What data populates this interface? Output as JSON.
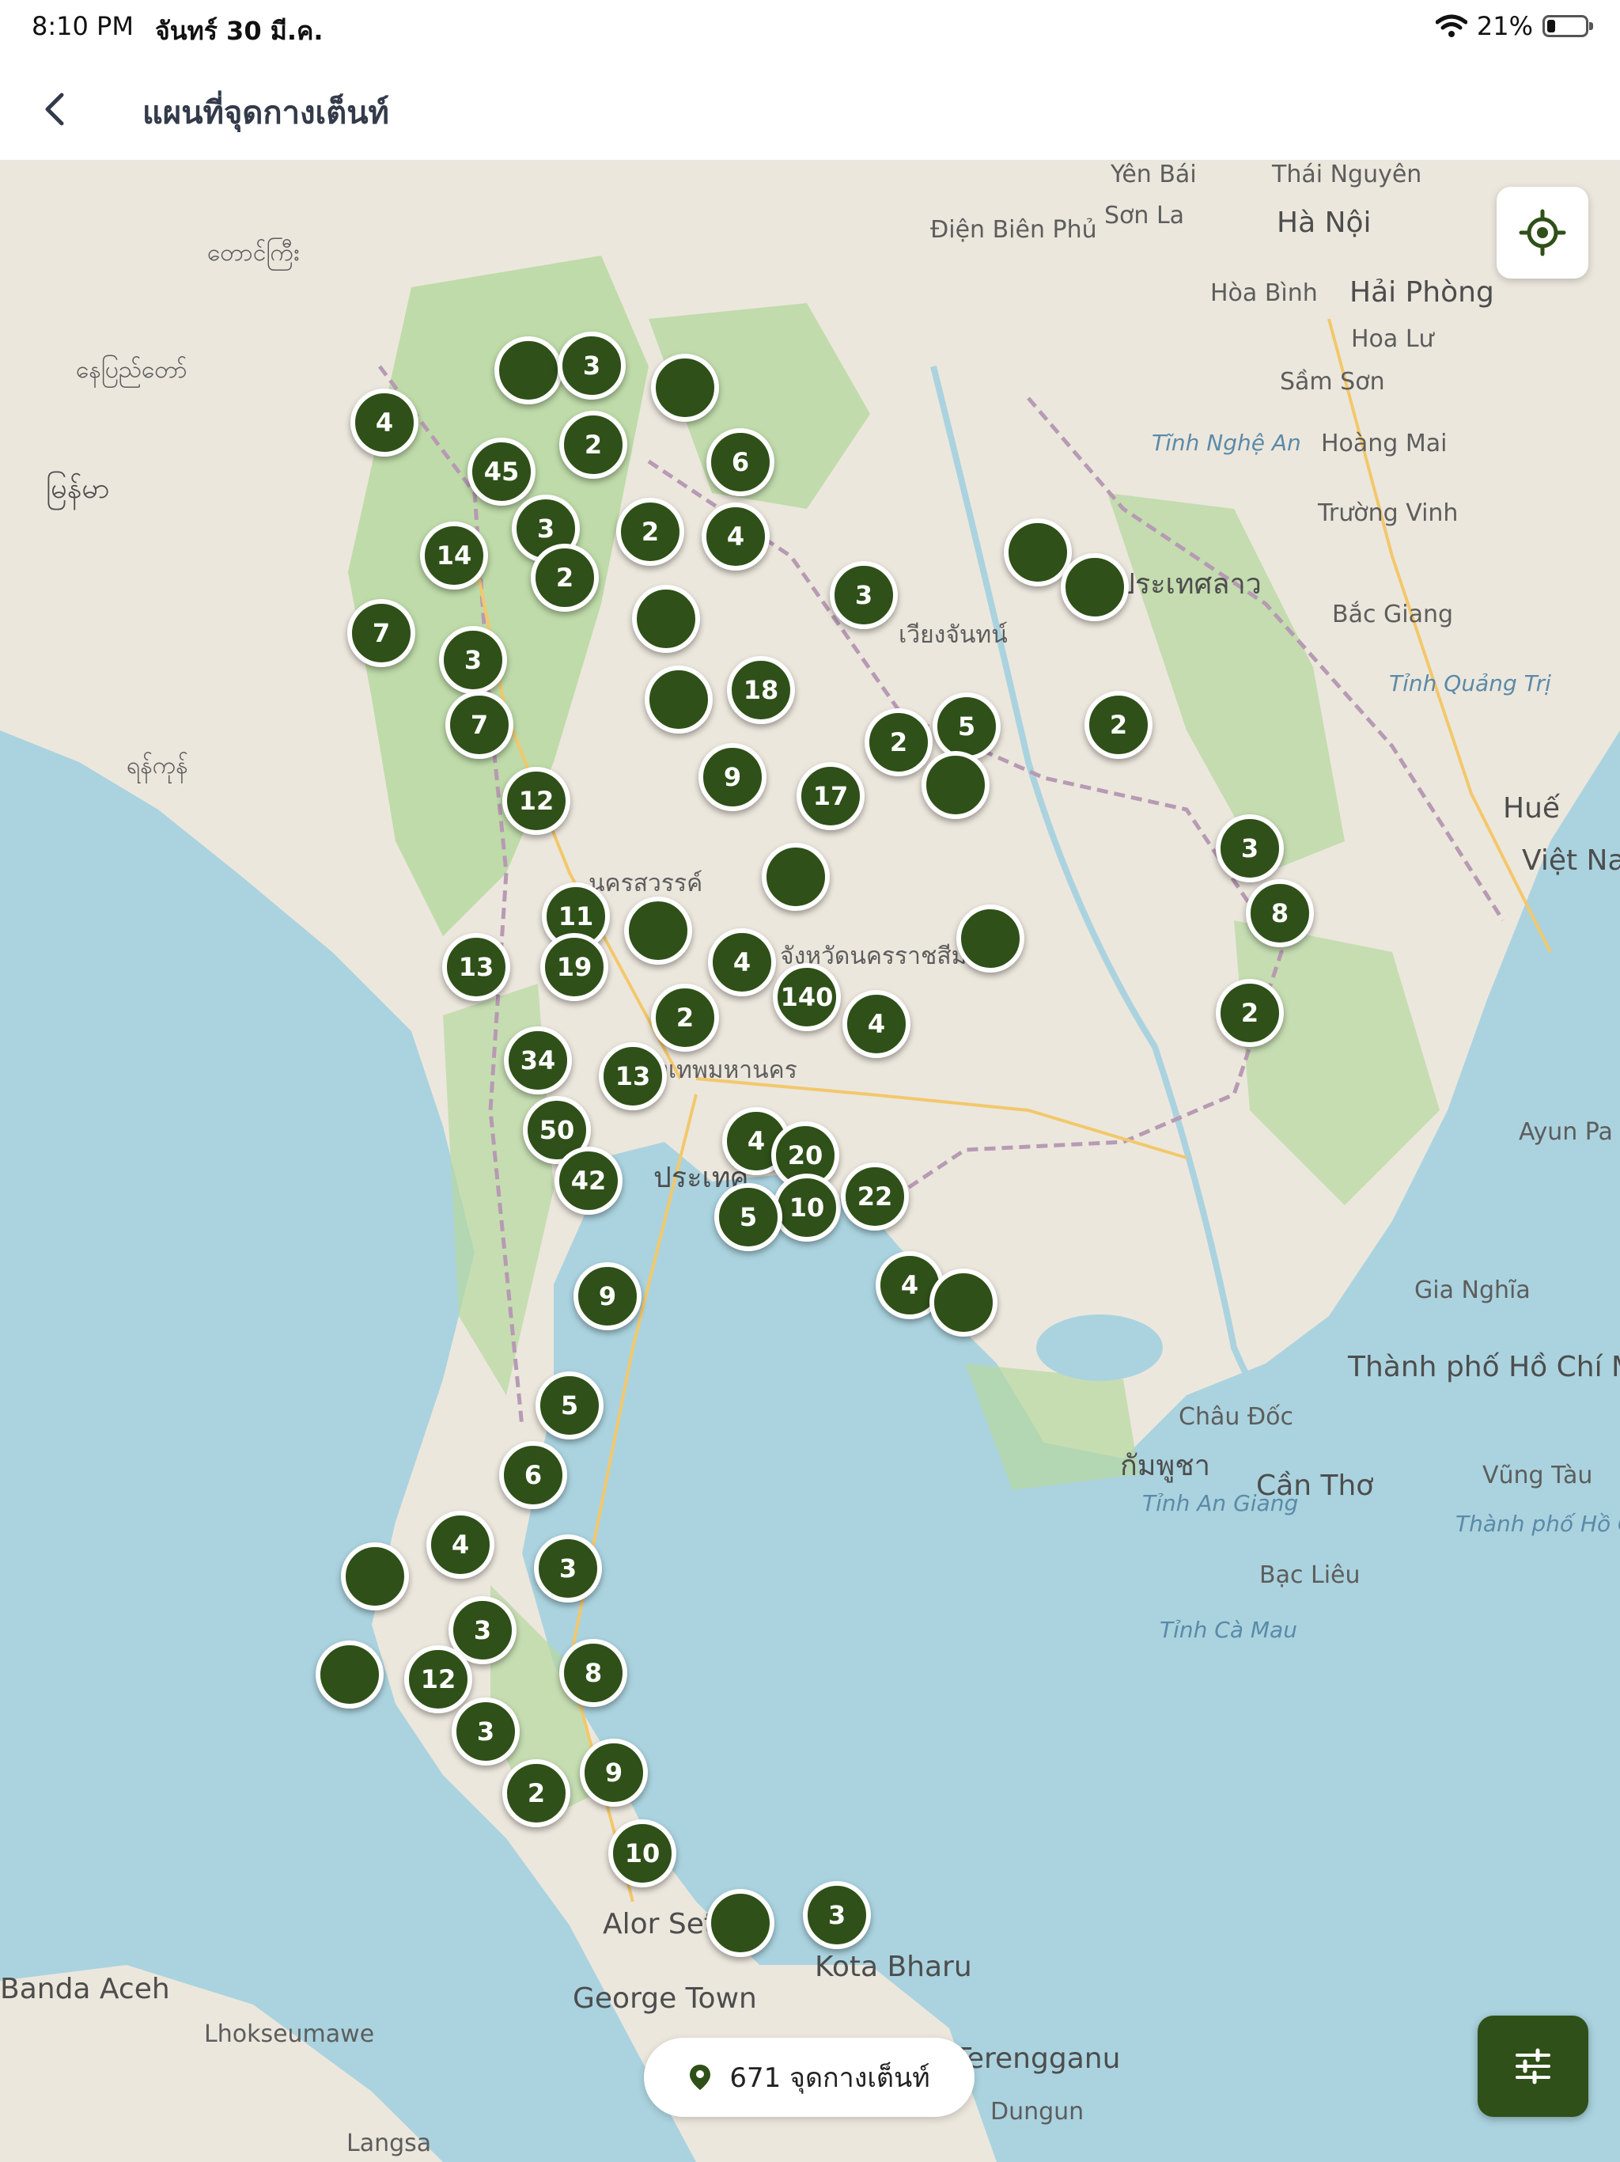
{
  "status": {
    "time": "8:10 PM",
    "date": "จันทร์ 30 มี.ค.",
    "battery": "21%",
    "battery_level": 0.21
  },
  "nav": {
    "title": "แผนที่จุดกางเต็นท์"
  },
  "map": {
    "labels": [
      "Yên Bái",
      "Thái Nguyên",
      "Sơn La",
      "Hà Nội",
      "Điện Biên Phủ",
      "Hòa Bình",
      "Hải Phòng",
      "Hoa Lư",
      "Sầm Sơn",
      "Tĩnh Nghệ An",
      "Hoàng Mai",
      "Trường Vinh",
      "Bắc Giang",
      "Tỉnh Quảng Trị",
      "Huế",
      "Việt Nam",
      "Ayun Pa",
      "Gia Nghĩa",
      "Thành phố Hồ Chí Minh",
      "Châu Đốc",
      "Cần Thơ",
      "Vũng Tàu",
      "Tỉnh An Giang",
      "Bạc Liêu",
      "Tỉnh Cà Mau",
      "Thành phố Hồ Chí Minh",
      "George Town",
      "Alor Setar",
      "Kota Bharu",
      "Terengganu",
      "Dungun",
      "Banda Aceh",
      "Lhokseumawe",
      "Langsa",
      "နေပြည်တော်",
      "တောင်ကြီး",
      "မြန်မာ",
      "ရန်ကုန်",
      "ประเทศ",
      "กรุงเทพมหานคร",
      "นครสวรรค์",
      "จังหวัดนครราชสีมา",
      "เวียงจันทน์",
      "ประเทศลาว",
      "กัมพูชา"
    ]
  },
  "clusters": [
    {
      "label": ""
    },
    {
      "label": "3"
    },
    {
      "label": ""
    },
    {
      "label": "4"
    },
    {
      "label": "2"
    },
    {
      "label": "45"
    },
    {
      "label": "6"
    },
    {
      "label": "3"
    },
    {
      "label": "2"
    },
    {
      "label": "4"
    },
    {
      "label": "14"
    },
    {
      "label": "2"
    },
    {
      "label": ""
    },
    {
      "label": "3"
    },
    {
      "label": ""
    },
    {
      "label": ""
    },
    {
      "label": "7"
    },
    {
      "label": "3"
    },
    {
      "label": ""
    },
    {
      "label": "18"
    },
    {
      "label": "7"
    },
    {
      "label": "5"
    },
    {
      "label": "2"
    },
    {
      "label": "2"
    },
    {
      "label": ""
    },
    {
      "label": "9"
    },
    {
      "label": "17"
    },
    {
      "label": "12"
    },
    {
      "label": "3"
    },
    {
      "label": ""
    },
    {
      "label": "8"
    },
    {
      "label": "11"
    },
    {
      "label": ""
    },
    {
      "label": ""
    },
    {
      "label": "13"
    },
    {
      "label": "19"
    },
    {
      "label": "4"
    },
    {
      "label": "140"
    },
    {
      "label": "2"
    },
    {
      "label": "4"
    },
    {
      "label": "2"
    },
    {
      "label": "34"
    },
    {
      "label": "13"
    },
    {
      "label": "50"
    },
    {
      "label": "4"
    },
    {
      "label": "20"
    },
    {
      "label": "42"
    },
    {
      "label": "10"
    },
    {
      "label": "5"
    },
    {
      "label": "22"
    },
    {
      "label": "9"
    },
    {
      "label": "4"
    },
    {
      "label": ""
    },
    {
      "label": "5"
    },
    {
      "label": "6"
    },
    {
      "label": "4"
    },
    {
      "label": ""
    },
    {
      "label": "3"
    },
    {
      "label": "3"
    },
    {
      "label": ""
    },
    {
      "label": "12"
    },
    {
      "label": "8"
    },
    {
      "label": "3"
    },
    {
      "label": "9"
    },
    {
      "label": "2"
    },
    {
      "label": "10"
    },
    {
      "label": ""
    },
    {
      "label": "3"
    }
  ],
  "footer": {
    "count_text": "671 จุดกางเต็นท์"
  },
  "icons": {
    "back": "chevron-left-icon",
    "locate": "crosshair-icon",
    "pin": "map-pin-icon",
    "filter": "sliders-icon"
  },
  "colors": {
    "accent": "#2f5018",
    "water": "#aad3df",
    "land": "#ece7dd",
    "forest": "#a7cf8f"
  }
}
